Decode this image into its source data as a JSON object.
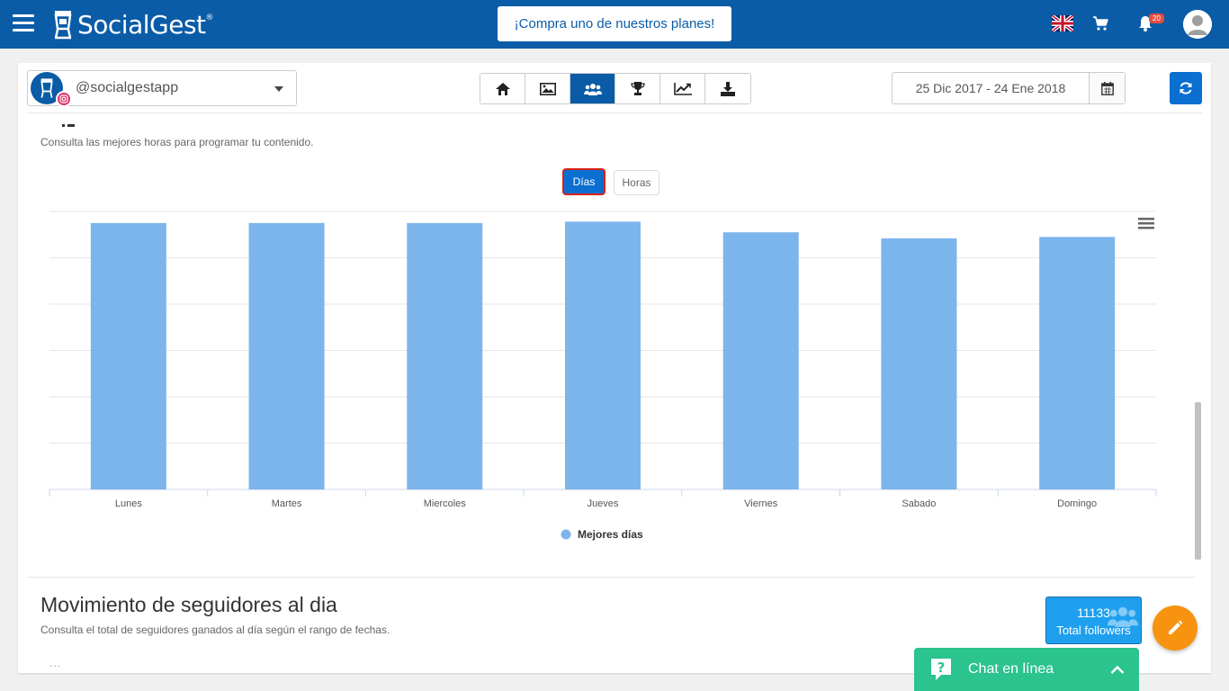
{
  "header": {
    "logo_text": "SocialGest",
    "logo_trademark": "®",
    "promo_label": "¡Compra uno de nuestros planes!",
    "notification_count": "20",
    "icons": [
      "menu-icon",
      "uk-flag-icon",
      "cart-icon",
      "bell-icon",
      "user-avatar-icon"
    ]
  },
  "toolbar": {
    "account_name": "@socialgestapp",
    "tabs": [
      {
        "icon": "home-icon",
        "active": false
      },
      {
        "icon": "image-icon",
        "active": false
      },
      {
        "icon": "users-icon",
        "active": true
      },
      {
        "icon": "trophy-icon",
        "active": false
      },
      {
        "icon": "line-chart-icon",
        "active": false
      },
      {
        "icon": "download-icon",
        "active": false
      }
    ],
    "date_range": "25 Dic 2017 - 24 Ene 2018"
  },
  "best_times": {
    "subtitle": "Consulta las mejores horas para programar tu contenido.",
    "toggle_days": "Días",
    "toggle_hours": "Horas"
  },
  "chart_data": {
    "type": "bar",
    "categories": [
      "Lunes",
      "Martes",
      "Miercoles",
      "Jueves",
      "Viernes",
      "Sabado",
      "Domingo"
    ],
    "series": [
      {
        "name": "Mejores días",
        "values": [
          5.75,
          5.75,
          5.75,
          5.78,
          5.55,
          5.42,
          5.45
        ],
        "color": "#7cb5ec"
      }
    ],
    "ylim": [
      0,
      6
    ],
    "grid": true,
    "legend": "bottom-center",
    "title": "",
    "xlabel": "",
    "ylabel": ""
  },
  "followers_section": {
    "title": "Movimiento de seguidores al dia",
    "subtitle": "Consulta el total de seguidores ganados al día según el rango de fechas.",
    "dots": "...",
    "total_followers_count": "11133",
    "total_followers_label": "Total followers"
  },
  "chat": {
    "label": "Chat en línea"
  },
  "colors": {
    "brand": "#0a5ca7",
    "accent": "#0a6fd1",
    "bar": "#7cb5ec",
    "fab": "#f7930e",
    "chat": "#2bc38e"
  }
}
